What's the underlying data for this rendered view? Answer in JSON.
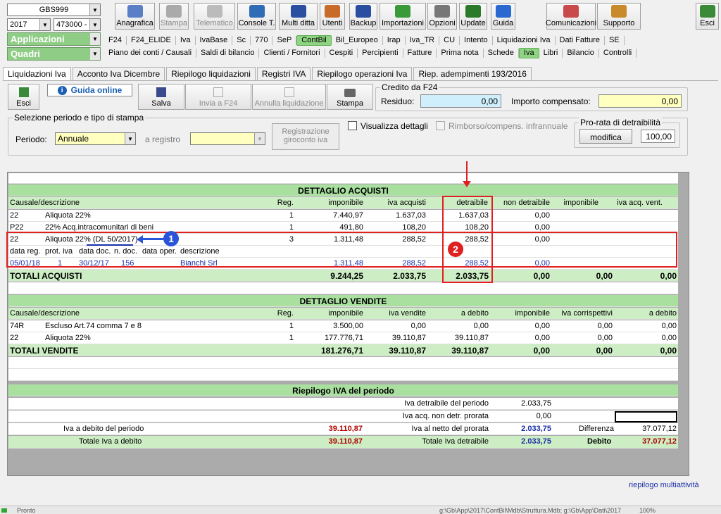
{
  "selectors": {
    "company": "GBS999",
    "year": "2017",
    "code": "473000 -",
    "apps_label": "Applicazioni",
    "quadri_label": "Quadri"
  },
  "toolbar": [
    {
      "label": "Anagrafica",
      "icon": "anagrafica-icon",
      "enabled": true
    },
    {
      "label": "Stampa",
      "icon": "printer-icon",
      "enabled": false
    },
    {
      "label": "Telematico",
      "icon": "telematico-icon",
      "enabled": false
    },
    {
      "label": "Console T.",
      "icon": "console-icon",
      "enabled": true
    },
    {
      "label": "Multi ditta",
      "icon": "multi-ditta-icon",
      "enabled": true
    },
    {
      "label": "Utenti",
      "icon": "users-icon",
      "enabled": true
    },
    {
      "label": "Backup",
      "icon": "backup-icon",
      "enabled": true
    },
    {
      "label": "Importazioni",
      "icon": "import-icon",
      "enabled": true
    },
    {
      "label": "Opzioni",
      "icon": "tools-icon",
      "enabled": true
    },
    {
      "label": "Update",
      "icon": "update-icon",
      "enabled": true
    },
    {
      "label": "Guida",
      "icon": "help-icon",
      "enabled": true
    },
    {
      "label": "Comunicazioni",
      "icon": "comunicazioni-icon",
      "enabled": true
    },
    {
      "label": "Supporto",
      "icon": "support-icon",
      "enabled": true
    },
    {
      "label": "Esci",
      "icon": "exit-icon",
      "enabled": true
    }
  ],
  "menu1": [
    "F24",
    "F24_ELIDE",
    "Iva",
    "IvaBase",
    "Sc",
    "770",
    "SeP",
    "ContBil",
    "Bil_Europeo",
    "Irap",
    "Iva_TR",
    "CU",
    "Intento",
    "Liquidazioni Iva",
    "Dati Fatture",
    "SE"
  ],
  "menu1_active": "ContBil",
  "menu2": [
    "Piano dei conti / Causali",
    "Saldi di bilancio",
    "Clienti / Fornitori",
    "Cespiti",
    "Percipienti",
    "Fatture",
    "Prima nota",
    "Schede",
    "Iva",
    "Libri",
    "Bilancio",
    "Controlli"
  ],
  "menu2_active": "Iva",
  "tabs": [
    "Liquidazioni Iva",
    "Acconto Iva Dicembre",
    "Riepilogo liquidazioni",
    "Registri IVA",
    "Riepilogo operazioni Iva",
    "Riep. adempimenti 193/2016"
  ],
  "actions": {
    "esci": "Esci",
    "guida": "Guida online",
    "salva": "Salva",
    "invia": "Invia a F24",
    "annulla": "Annulla liquidazione",
    "stampa": "Stampa"
  },
  "credito": {
    "title": "Credito da F24",
    "residuo_label": "Residuo:",
    "residuo": "0,00",
    "compensato_label": "Importo compensato:",
    "compensato": "0,00"
  },
  "selezione": {
    "title": "Selezione periodo e tipo di stampa",
    "periodo_label": "Periodo:",
    "periodo": "Annuale",
    "registro_label": "a registro",
    "registrazione": "Registrazione giroconto iva",
    "visualizza": "Visualizza dettagli",
    "rimborso": "Rimborso/compens. infrannuale"
  },
  "prorata": {
    "title": "Pro-rata di detraibilità",
    "button": "modifica",
    "value": "100,00"
  },
  "acquisti": {
    "title": "DETTAGLIO ACQUISTI",
    "headers": [
      "Causale/descrizione",
      "Reg.",
      "imponibile",
      "iva acquisti",
      "detraibile",
      "non detraibile",
      "imponibile",
      "iva acq. vent."
    ],
    "rows": [
      [
        "22",
        "Aliquota 22%",
        "1",
        "7.440,97",
        "1.637,03",
        "1.637,03",
        "0,00"
      ],
      [
        "P22",
        "22% Acq.intracomunitari di beni",
        "1",
        "491,80",
        "108,20",
        "108,20",
        "0,00"
      ],
      [
        "22",
        "Aliquota 22% (DL 50/2017)",
        "3",
        "1.311,48",
        "288,52",
        "288,52",
        "0,00"
      ]
    ],
    "detail_headers": [
      "data reg.",
      "prot. iva",
      "data doc.",
      "n. doc.",
      "data oper.",
      "descrizione"
    ],
    "detail": [
      "05/01/18",
      "1",
      "30/12/17",
      "156",
      "Bianchi Srl",
      "1.311,48",
      "288,52",
      "288,52",
      "0,00"
    ],
    "totals": [
      "TOTALI ACQUISTI",
      "9.244,25",
      "2.033,75",
      "2.033,75",
      "0,00",
      "0,00",
      "0,00"
    ]
  },
  "vendite": {
    "title": "DETTAGLIO VENDITE",
    "headers": [
      "Causale/descrizione",
      "Reg.",
      "imponibile",
      "iva vendite",
      "a debito",
      "imponibile",
      "iva corrispettivi",
      "a debito"
    ],
    "rows": [
      [
        "74R",
        "Escluso Art.74 comma 7 e 8",
        "1",
        "3.500,00",
        "0,00",
        "0,00",
        "0,00",
        "0,00",
        "0,00"
      ],
      [
        "22",
        "Aliquota 22%",
        "1",
        "177.776,71",
        "39.110,87",
        "39.110,87",
        "0,00",
        "0,00",
        "0,00"
      ]
    ],
    "totals": [
      "TOTALI VENDITE",
      "181.276,71",
      "39.110,87",
      "39.110,87",
      "0,00",
      "0,00",
      "0,00"
    ]
  },
  "riepilogo": {
    "title": "Riepilogo IVA del periodo",
    "detraibile_label": "Iva detraibile del periodo",
    "detraibile": "2.033,75",
    "nondetr_label": "Iva acq. non detr. prorata",
    "nondetr": "0,00",
    "debito_label": "Iva a debito del periodo",
    "debito": "39.110,87",
    "netto_label": "Iva al netto del prorata",
    "netto": "2.033,75",
    "differenza_label": "Differenza",
    "differenza": "37.077,12",
    "tot_debito_label": "Totale Iva a debito",
    "tot_debito": "39.110,87",
    "tot_detr_label": "Totale Iva detraibile",
    "tot_detr": "2.033,75",
    "esito_label": "Debito",
    "esito": "37.077,12"
  },
  "annotations": {
    "one": "1",
    "two": "2"
  },
  "multiattivita": "riepilogo multiattività",
  "status": {
    "left": "Pronto",
    "path": "g:\\Gb\\App\\2017\\ContBil\\Mdb\\Struttura.Mdb; g:\\Gb\\App\\Dati\\2017",
    "zoom": "100%"
  }
}
